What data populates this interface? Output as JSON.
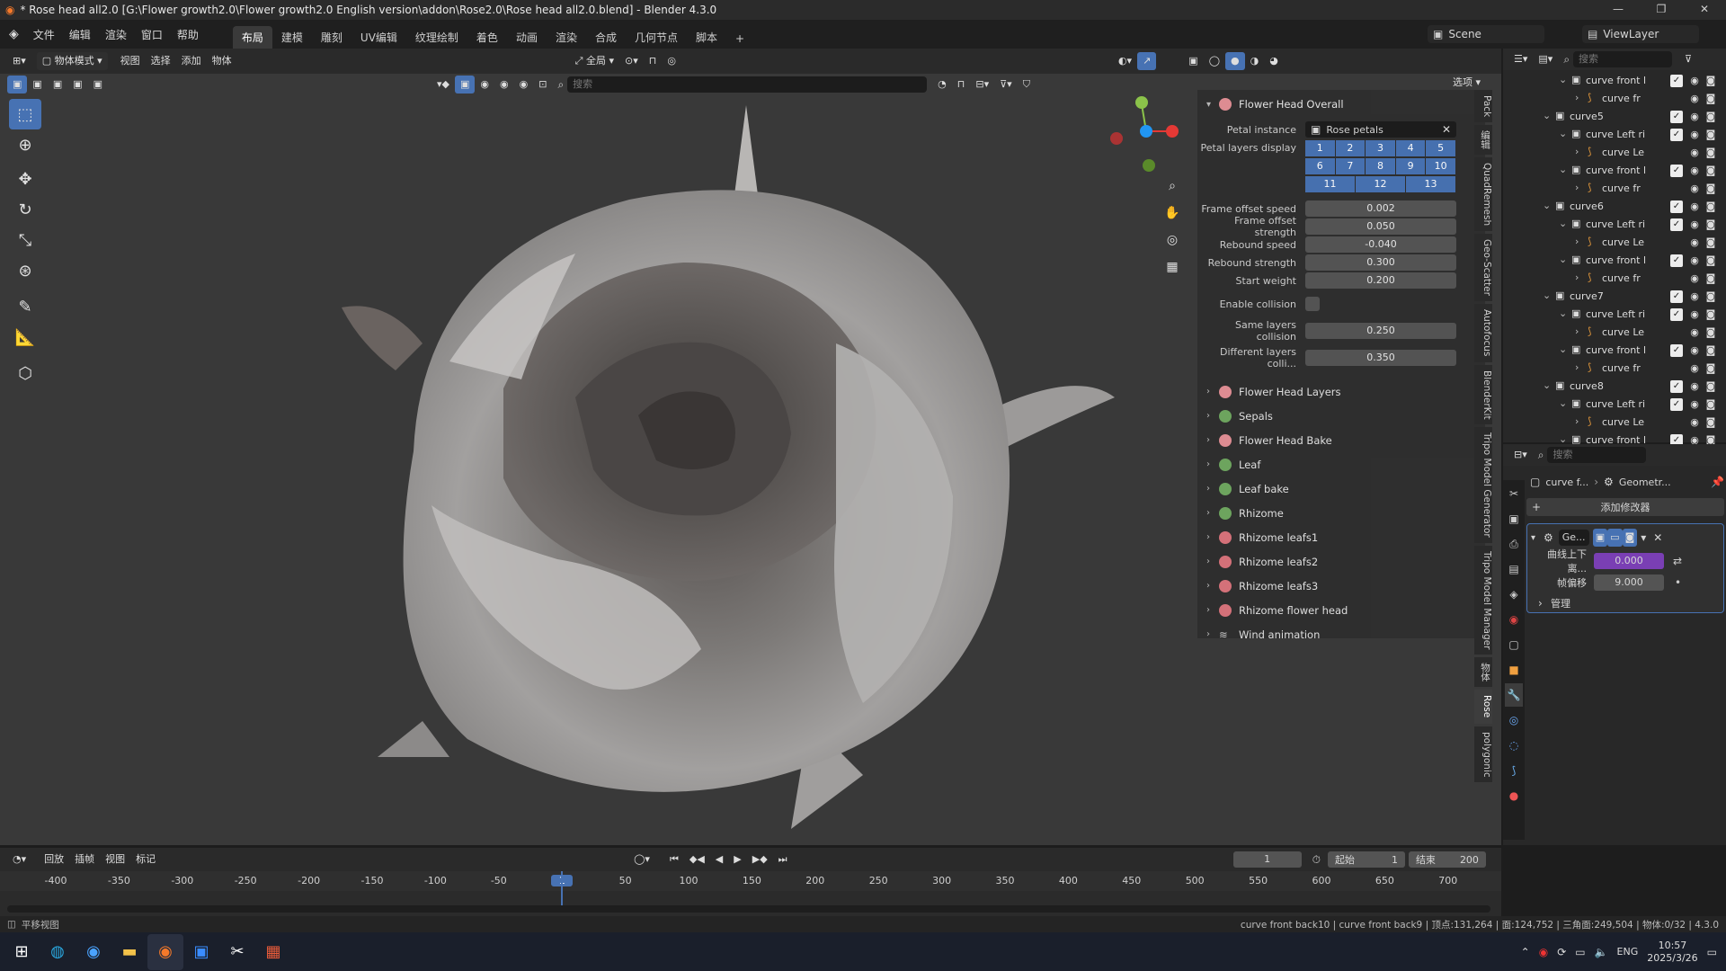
{
  "window": {
    "title": "* Rose head all2.0 [G:\\Flower growth2.0\\Flower growth2.0 English version\\addon\\Rose2.0\\Rose head all2.0.blend] - Blender 4.3.0",
    "minimize": "—",
    "maximize": "❐",
    "close": "✕"
  },
  "menu": {
    "items": [
      "文件",
      "编辑",
      "渲染",
      "窗口",
      "帮助"
    ],
    "workspaces": [
      "布局",
      "建模",
      "雕刻",
      "UV编辑",
      "纹理绘制",
      "着色",
      "动画",
      "渲染",
      "合成",
      "几何节点",
      "脚本"
    ],
    "add_tab": "+",
    "scene": "Scene",
    "view_layer": "ViewLayer"
  },
  "viewport_header": {
    "mode": "物体模式",
    "items": [
      "视图",
      "选择",
      "添加",
      "物体"
    ],
    "transform": "全局",
    "search_placeholder": "搜索",
    "options": "选项"
  },
  "npanel": {
    "title": "Flower Head Overall",
    "petal_instance_label": "Petal instance",
    "petal_instance_value": "Rose petals",
    "petal_layers_label": "Petal layers display",
    "petal_layers": [
      [
        "1",
        "2",
        "3",
        "4",
        "5"
      ],
      [
        "6",
        "7",
        "8",
        "9",
        "10"
      ],
      [
        "11",
        "12",
        "13"
      ]
    ],
    "props": [
      {
        "label": "Frame offset speed",
        "value": "0.002"
      },
      {
        "label": "Frame offset strength",
        "value": "0.050"
      },
      {
        "label": "Rebound speed",
        "value": "-0.040"
      },
      {
        "label": "Rebound strength",
        "value": "0.300"
      },
      {
        "label": "Start weight",
        "value": "0.200"
      }
    ],
    "enable_collision": "Enable collision",
    "same_layers_label": "Same layers collision",
    "same_layers_value": "0.250",
    "different_layers_label": "Different layers colli...",
    "different_layers_value": "0.350",
    "subpanels": [
      "Flower Head Layers",
      "Sepals",
      "Flower Head Bake",
      "Leaf",
      "Leaf bake",
      "Rhizome",
      "Rhizome leafs1",
      "Rhizome leafs2",
      "Rhizome leafs3",
      "Rhizome flower head",
      "Wind animation"
    ]
  },
  "side_tabs": [
    "Pack",
    "编辑",
    "QuadRemesh",
    "Geo-Scatter",
    "Autofocus",
    "BlenderKit",
    "Tripo Model Generator",
    "Tripo Model Manager",
    "物体",
    "Rose",
    "polygonic"
  ],
  "outliner": {
    "search_placeholder": "搜索",
    "rows": [
      {
        "indent": 4,
        "name": "curve front l",
        "type": "obj"
      },
      {
        "indent": 5,
        "name": "curve fr",
        "type": "curve"
      },
      {
        "indent": 3,
        "name": "curve5",
        "type": "coll"
      },
      {
        "indent": 4,
        "name": "curve Left ri",
        "type": "obj"
      },
      {
        "indent": 5,
        "name": "curve Le",
        "type": "curve"
      },
      {
        "indent": 4,
        "name": "curve front l",
        "type": "obj"
      },
      {
        "indent": 5,
        "name": "curve fr",
        "type": "curve"
      },
      {
        "indent": 3,
        "name": "curve6",
        "type": "coll"
      },
      {
        "indent": 4,
        "name": "curve Left ri",
        "type": "obj"
      },
      {
        "indent": 5,
        "name": "curve Le",
        "type": "curve"
      },
      {
        "indent": 4,
        "name": "curve front l",
        "type": "obj"
      },
      {
        "indent": 5,
        "name": "curve fr",
        "type": "curve"
      },
      {
        "indent": 3,
        "name": "curve7",
        "type": "coll"
      },
      {
        "indent": 4,
        "name": "curve Left ri",
        "type": "obj"
      },
      {
        "indent": 5,
        "name": "curve Le",
        "type": "curve"
      },
      {
        "indent": 4,
        "name": "curve front l",
        "type": "obj"
      },
      {
        "indent": 5,
        "name": "curve fr",
        "type": "curve"
      },
      {
        "indent": 3,
        "name": "curve8",
        "type": "coll"
      },
      {
        "indent": 4,
        "name": "curve Left ri",
        "type": "obj"
      },
      {
        "indent": 5,
        "name": "curve Le",
        "type": "curve"
      },
      {
        "indent": 4,
        "name": "curve front l",
        "type": "obj"
      }
    ]
  },
  "properties": {
    "search_placeholder": "搜索",
    "breadcrumb_obj": "curve f...",
    "breadcrumb_mod": "Geometr...",
    "add_modifier": "添加修改器",
    "modifier_name": "Ge...",
    "field1_label": "曲线上下离...",
    "field1_value": "0.000",
    "field2_label": "帧偏移",
    "field2_value": "9.000",
    "manage": "管理"
  },
  "timeline": {
    "menu": [
      "回放",
      "插帧",
      "视图",
      "标记"
    ],
    "current_frame": "1",
    "start_label": "起始",
    "start": "1",
    "end_label": "结束",
    "end": "200",
    "ticks": [
      "-400",
      "-350",
      "-300",
      "-250",
      "-200",
      "-150",
      "-100",
      "-50",
      "1",
      "50",
      "100",
      "150",
      "200",
      "250",
      "300",
      "350",
      "400",
      "450",
      "500",
      "550",
      "600",
      "650",
      "700"
    ],
    "accent": "#4772b3"
  },
  "status": {
    "left": "平移视图",
    "right": "curve front back10 | curve front back9 | 顶点:131,264 | 面:124,752 | 三角面:249,504 | 物体:0/32 | 4.3.0"
  },
  "taskbar": {
    "lang": "ENG",
    "time": "10:57",
    "date": "2025/3/26"
  }
}
